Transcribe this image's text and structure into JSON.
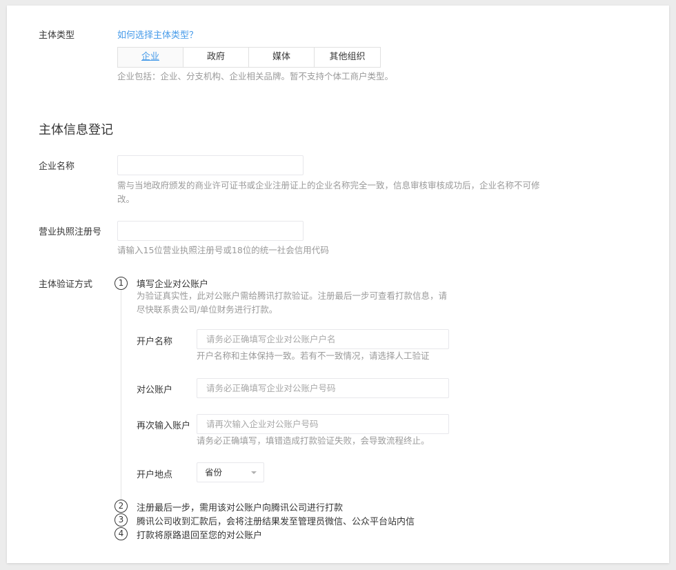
{
  "subject_type": {
    "label": "主体类型",
    "help_link": "如何选择主体类型？",
    "tabs": [
      "企业",
      "政府",
      "媒体",
      "其他组织"
    ],
    "active_tab": "企业",
    "tip": "企业包括：企业、分支机构、企业相关品牌。暂不支持个体工商户类型。"
  },
  "section_title": "主体信息登记",
  "company_name": {
    "label": "企业名称",
    "value": "",
    "tip_line1": "需与当地政府颁发的商业许可证书或企业注册证上的企业名称完全一致，信息审核审核成功后，企业名称不可修",
    "tip_line2": "改。"
  },
  "license_no": {
    "label": "营业执照注册号",
    "value": "",
    "tip": "请输入15位营业执照注册号或18位的统一社会信用代码"
  },
  "verify": {
    "label": "主体验证方式",
    "steps": [
      {
        "num": "1",
        "title": "填写企业对公账户"
      },
      {
        "num": "2",
        "title": "注册最后一步，需用该对公账户向腾讯公司进行打款"
      },
      {
        "num": "3",
        "title": "腾讯公司收到汇款后，会将注册结果发至管理员微信、公众平台站内信"
      },
      {
        "num": "4",
        "title": "打款将原路退回至您的对公账户"
      }
    ],
    "step1_desc_line1": "为验证真实性，此对公账户需给腾讯打款验证。注册最后一步可查看打款信息，请",
    "step1_desc_line2": "尽快联系贵公司/单位财务进行打款。",
    "account_name": {
      "label": "开户名称",
      "placeholder": "请务必正确填写企业对公账户户名",
      "tip": "开户名称和主体保持一致。若有不一致情况，请选择人工验证"
    },
    "account_no": {
      "label": "对公账户",
      "placeholder": "请务必正确填写企业对公账户号码"
    },
    "account_no_confirm": {
      "label": "再次输入账户",
      "placeholder": "请再次输入企业对公账户号码",
      "tip": "请务必正确填写，填错造成打款验证失败，会导致流程终止。"
    },
    "location": {
      "label": "开户地点",
      "selected": "省份"
    }
  },
  "colors": {
    "link": "#459ae9",
    "text": "#353535",
    "tip": "#9a9a9a",
    "border": "#e7e7eb"
  }
}
